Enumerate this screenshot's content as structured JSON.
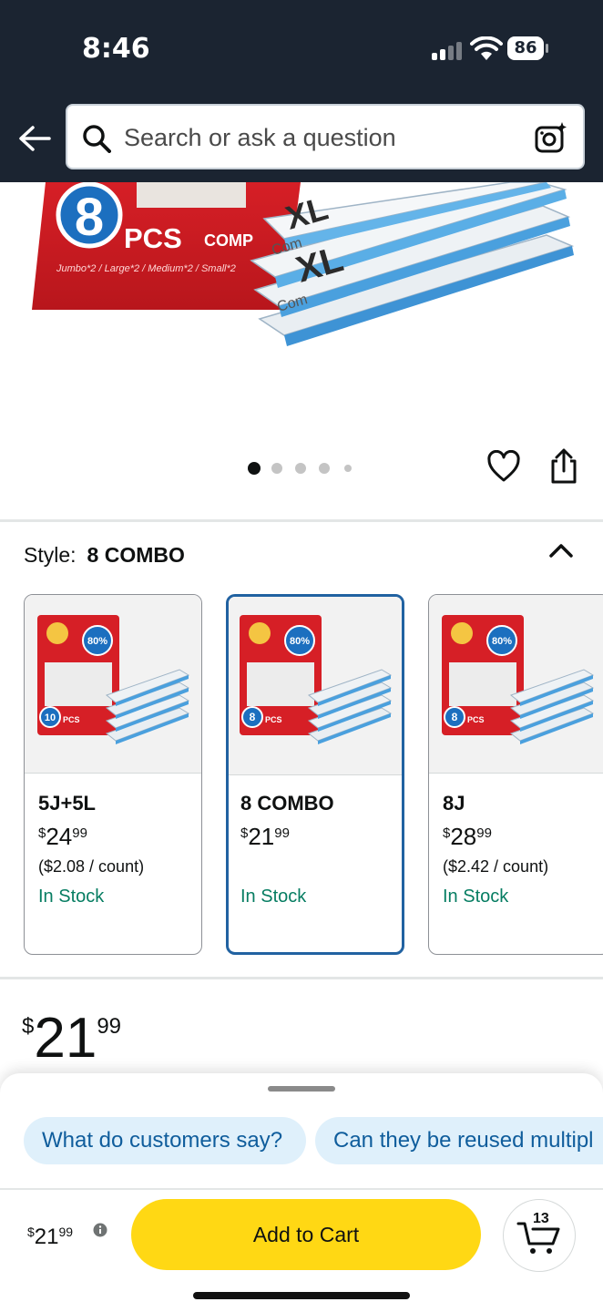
{
  "status_bar": {
    "time": "8:46",
    "battery": "86",
    "icons": [
      "signal-icon",
      "wifi-icon",
      "battery-icon"
    ]
  },
  "header": {
    "search_placeholder": "Search or ask a question",
    "icons": [
      "back-arrow-icon",
      "search-icon",
      "camera-icon"
    ]
  },
  "product_image": {
    "package_count": "8",
    "package_unit": "PCS",
    "package_subtitle": "Jumbo*2 / Large*2 / Medium*2 / Small*2",
    "carousel_dots": 5,
    "active_dot": 1
  },
  "style": {
    "label": "Style:",
    "value": "8 COMBO",
    "options": [
      {
        "name": "5J+5L",
        "price_whole": "24",
        "price_fraction": "99",
        "unit_price": "($2.08 / count)",
        "stock": "In Stock",
        "pcs": "10",
        "selected": false
      },
      {
        "name": "8 COMBO",
        "price_whole": "21",
        "price_fraction": "99",
        "unit_price": "",
        "stock": "In Stock",
        "pcs": "8",
        "selected": true
      },
      {
        "name": "8J",
        "price_whole": "28",
        "price_fraction": "99",
        "unit_price": "($2.42 / count)",
        "stock": "In Stock",
        "pcs": "8",
        "selected": false
      }
    ],
    "badge_text": "Save 80% Of Space"
  },
  "price": {
    "currency": "$",
    "whole": "21",
    "fraction": "99"
  },
  "bottom_sheet": {
    "chips": [
      "What do customers say?",
      "Can they be reused multipl"
    ],
    "footer_price_currency": "$",
    "footer_price_whole": "21",
    "footer_price_fraction": "99",
    "add_to_cart_label": "Add to Cart",
    "cart_count": "13"
  },
  "colors": {
    "header_bg": "#1b2431",
    "accent_blue": "#2162a1",
    "stock_green": "#067d62",
    "cta_yellow": "#ffd814",
    "chip_bg": "#dff0fb"
  }
}
